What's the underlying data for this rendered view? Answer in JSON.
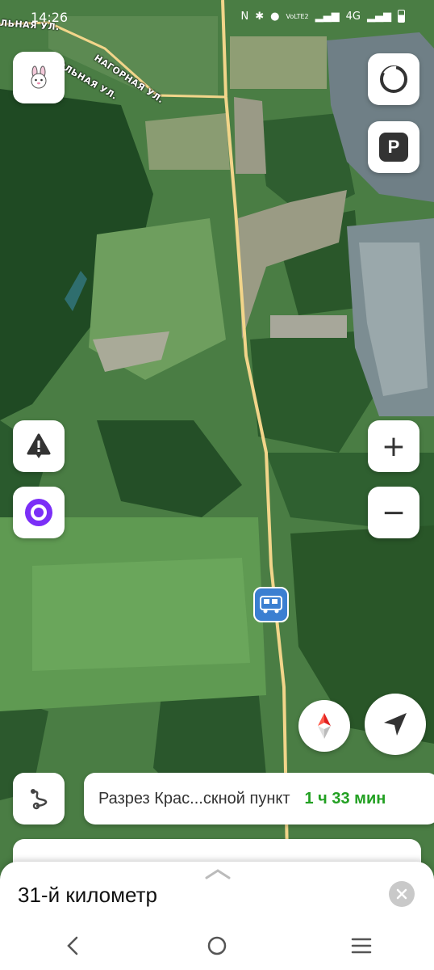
{
  "status_bar": {
    "time": "14:26",
    "icons": [
      "nfc-icon",
      "bluetooth-icon",
      "location-icon",
      "volte-icon",
      "signal-icon",
      "4g-icon",
      "signal-icon",
      "battery-icon"
    ],
    "volte_text": "VoLTE2",
    "network_text": "4G"
  },
  "map": {
    "type": "satellite",
    "street_labels": [
      "НАГОРНАЯ УЛ.",
      "ОЛЬНАЯ УЛ.",
      "ЛЬНАЯ УЛ."
    ],
    "road_color": "#f2d58a"
  },
  "controls": {
    "profile_icon": "bunny-icon",
    "layers_icon": "circle-icon",
    "parking_label": "P",
    "report_icon": "warning-icon",
    "assistant_icon": "alice-icon",
    "zoom_in_label": "+",
    "zoom_out_label": "−",
    "compass_icon": "compass-icon",
    "locate_icon": "navigation-arrow-icon",
    "route_options_icon": "route-icon"
  },
  "route_chip": {
    "destination": "Разрез Крас...скной пункт",
    "eta": "1 ч 33 мин"
  },
  "bottom_sheet": {
    "title": "31-й километр",
    "close_icon": "close-icon"
  },
  "colors": {
    "eta": "#22a022",
    "alice": "#7b2ff7",
    "sheet_bg": "#ffffff"
  }
}
